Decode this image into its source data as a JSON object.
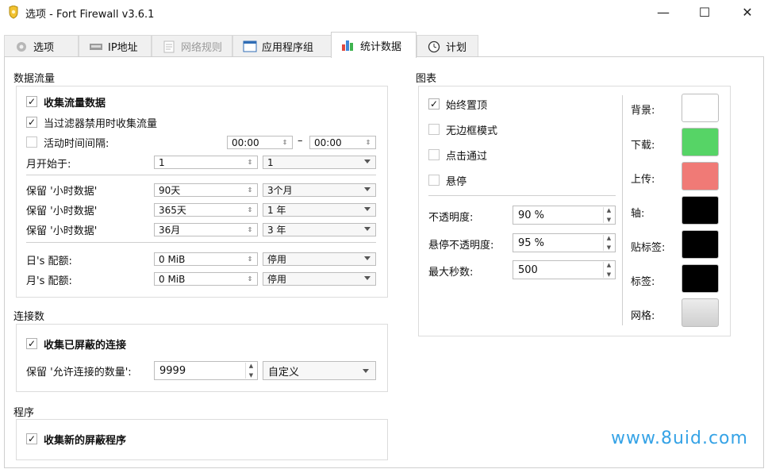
{
  "window": {
    "title": "选项 - Fort Firewall v3.6.1",
    "min": "—",
    "max": "☐",
    "close": "✕"
  },
  "tabs": [
    {
      "label": "选项",
      "icon": "gear-icon"
    },
    {
      "label": "IP地址",
      "icon": "network-card-icon"
    },
    {
      "label": "网络规则",
      "icon": "rules-icon"
    },
    {
      "label": "应用程序组",
      "icon": "window-icon"
    },
    {
      "label": "统计数据",
      "icon": "bar-chart-icon"
    },
    {
      "label": "计划",
      "icon": "clock-icon"
    }
  ],
  "traffic": {
    "title": "数据流量",
    "collect": "收集流量数据",
    "collect_when_disabled": "当过滤器禁用时收集流量",
    "active_period": "活动时间间隔:",
    "period_from": "00:00",
    "period_dash": "–",
    "period_to": "00:00",
    "month_start": "月开始于:",
    "month_start_value": "1",
    "month_start_select": "1",
    "keep_hourly_1": "保留 '小时数据'",
    "keep_hourly_1_value": "90天",
    "keep_hourly_1_select": "3个月",
    "keep_hourly_2": "保留 '小时数据'",
    "keep_hourly_2_value": "365天",
    "keep_hourly_2_select": "1 年",
    "keep_hourly_3": "保留 '小时数据'",
    "keep_hourly_3_value": "36月",
    "keep_hourly_3_select": "3 年",
    "day_quota": "日's 配额:",
    "day_quota_value": "0 MiB",
    "day_quota_select": "停用",
    "month_quota": "月's 配额:",
    "month_quota_value": "0 MiB",
    "month_quota_select": "停用"
  },
  "connections": {
    "title": "连接数",
    "collect_blocked": "收集已屏蔽的连接",
    "keep_allowed": "保留 '允许连接的数量':",
    "keep_allowed_value": "9999",
    "keep_allowed_select": "自定义"
  },
  "programs": {
    "title": "程序",
    "collect_new_blocked": "收集新的屏蔽程序"
  },
  "graph": {
    "title": "图表",
    "always_on_top": "始终置顶",
    "frameless": "无边框模式",
    "click_through": "点击通过",
    "hover": "悬停",
    "opacity_label": "不透明度:",
    "opacity_value": "90 %",
    "hover_opacity_label": "悬停不透明度:",
    "hover_opacity_value": "95 %",
    "max_seconds_label": "最大秒数:",
    "max_seconds_value": "500",
    "colors": [
      {
        "label": "背景:",
        "color": "#ffffff"
      },
      {
        "label": "下载:",
        "color": "#56d466"
      },
      {
        "label": "上传:",
        "color": "#f07a76"
      },
      {
        "label": "轴:",
        "color": "#000000"
      },
      {
        "label": "贴标签:",
        "color": "#000000"
      },
      {
        "label": "标签:",
        "color": "#000000"
      },
      {
        "label": "网格:",
        "color": "#dcdcdc"
      }
    ]
  },
  "watermark": "www.8uid.com"
}
